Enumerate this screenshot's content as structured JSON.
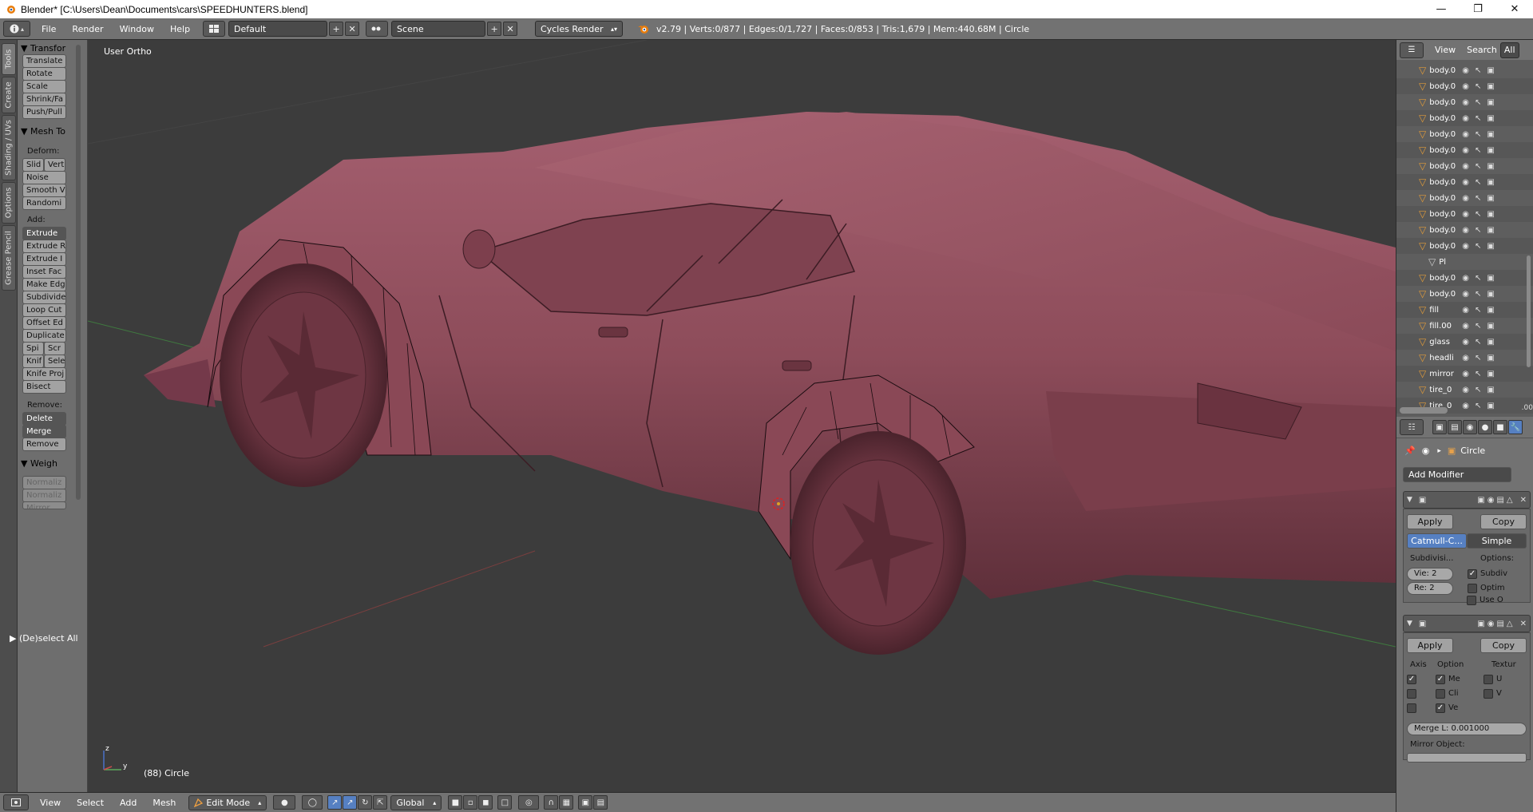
{
  "window": {
    "title": "Blender* [C:\\Users\\Dean\\Documents\\cars\\SPEEDHUNTERS.blend]",
    "minimize": "—",
    "maximize": "❐",
    "close": "✕"
  },
  "info_header": {
    "menus": [
      "File",
      "Render",
      "Window",
      "Help"
    ],
    "layout": "Default",
    "scene": "Scene",
    "engine": "Cycles Render",
    "stats": "v2.79 | Verts:0/877 | Edges:0/1,727 | Faces:0/853 | Tris:1,679 | Mem:440.68M | Circle"
  },
  "tool_tabs": [
    "Tools",
    "Create",
    "Shading / UVs",
    "Options",
    "Grease Pencil"
  ],
  "tool_shelf": {
    "transform_header": "▼ Transfor",
    "transform_buttons": [
      "Translate",
      "Rotate",
      "Scale",
      "Shrink/Fa",
      "Push/Pull"
    ],
    "mesh_tools_header": "▼ Mesh To",
    "deform_label": "Deform:",
    "deform_slide": "Slid",
    "deform_vert": "Vert",
    "deform_buttons": [
      "Noise",
      "Smooth V",
      "Randomi"
    ],
    "add_label": "Add:",
    "extrude": "Extrude",
    "add_buttons": [
      "Extrude R",
      "Extrude I",
      "Inset Fac",
      "Make Edg",
      "Subdivide",
      "Loop Cut",
      "Offset Ed",
      "Duplicate"
    ],
    "spin": "Spi",
    "screw": "Scr",
    "knife": "Knif",
    "select": "Sele",
    "knife_project": "Knife Proj",
    "bisect": "Bisect",
    "remove_label": "Remove:",
    "delete": "Delete",
    "merge": "Merge",
    "remove": "Remove",
    "weights_header": "▼ Weigh",
    "weight_buttons": [
      "Normaliz",
      "Normaliz",
      "Mirror"
    ],
    "deselect_all": "▶ (De)select All"
  },
  "viewport": {
    "view_label": "User Ortho",
    "object_label": "(88) Circle",
    "axis_z": "z",
    "axis_y": "y"
  },
  "viewport_header": {
    "menus": [
      "View",
      "Select",
      "Add",
      "Mesh"
    ],
    "mode": "Edit Mode",
    "orientation": "Global"
  },
  "outliner": {
    "view_menu": "View",
    "search_menu": "Search",
    "filter": "All",
    "rows": [
      "body.0",
      "body.0",
      "body.0",
      "body.0",
      "body.0",
      "body.0",
      "body.0",
      "body.0",
      "body.0",
      "body.0",
      "body.0",
      "body.0",
      "Pl",
      "body.0",
      "body.0",
      "fill",
      "fill.00",
      "glass",
      "headli",
      "mirror",
      "tire_0",
      "tire_0"
    ],
    "scroll_value": ".00"
  },
  "properties": {
    "object_name": "Circle",
    "add_modifier": "Add Modifier",
    "apply": "Apply",
    "copy": "Copy",
    "subsurf": {
      "catmull": "Catmull-C...",
      "simple": "Simple",
      "subdiv_label": "Subdivisi...",
      "options_label": "Options:",
      "view_levels": "Vie: 2",
      "render_levels": "Re: 2",
      "opt_subdiv": "Subdiv",
      "opt_optimal": "Optim",
      "opt_use_opensubdiv": "Use O"
    },
    "mirror": {
      "axis_label": "Axis",
      "option_label": "Option",
      "texture_label": "Textur",
      "opt_merge": "Me",
      "opt_clip": "Cli",
      "opt_vertex": "Ve",
      "tex_u": "U",
      "tex_v": "V",
      "merge_limit": "Merge L: 0.001000",
      "mirror_object": "Mirror Object:"
    }
  },
  "colors": {
    "car_body": "#8f4e5c",
    "viewport_bg": "#3c3c3c",
    "header_gray": "#727272",
    "accent_blue": "#5680c2"
  }
}
